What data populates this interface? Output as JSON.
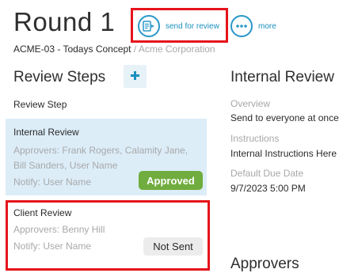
{
  "header": {
    "title": "Round 1",
    "breadcrumb": {
      "project": "ACME-03 - Todays Concept",
      "separator": "/",
      "organization": "Acme Corporation"
    },
    "actions": {
      "send_for_review": {
        "label": "send for review",
        "icon": "send-document-icon"
      },
      "more": {
        "label": "more",
        "icon": "ellipsis-icon"
      }
    }
  },
  "review_steps": {
    "heading": "Review Steps",
    "add_button_icon": "plus-icon",
    "column_label": "Review Step",
    "steps": [
      {
        "title": "Internal Review",
        "approvers": "Approvers: Frank Rogers, Calamity Jane, Bill Sanders, User Name",
        "notify": "Notify: User Name",
        "status": "Approved",
        "selected": true
      },
      {
        "title": "Client Review",
        "approvers": "Approvers: Benny Hill",
        "notify": "Notify: User Name",
        "status": "Not Sent",
        "selected": false
      }
    ]
  },
  "detail": {
    "heading": "Internal Review",
    "fields": [
      {
        "label": "Overview",
        "value": "Send to everyone at once"
      },
      {
        "label": "Instructions",
        "value": "Internal Instructions Here"
      },
      {
        "label": "Default Due Date",
        "value": "9/7/2023 5:00 PM"
      }
    ],
    "approvers_heading": "Approvers"
  },
  "colors": {
    "accent_blue": "#2a97c8",
    "selected_card_bg": "#dcedf8",
    "approved_green": "#70ad3e",
    "not_sent_gray": "#ececec",
    "highlight_red": "#e5141b"
  }
}
